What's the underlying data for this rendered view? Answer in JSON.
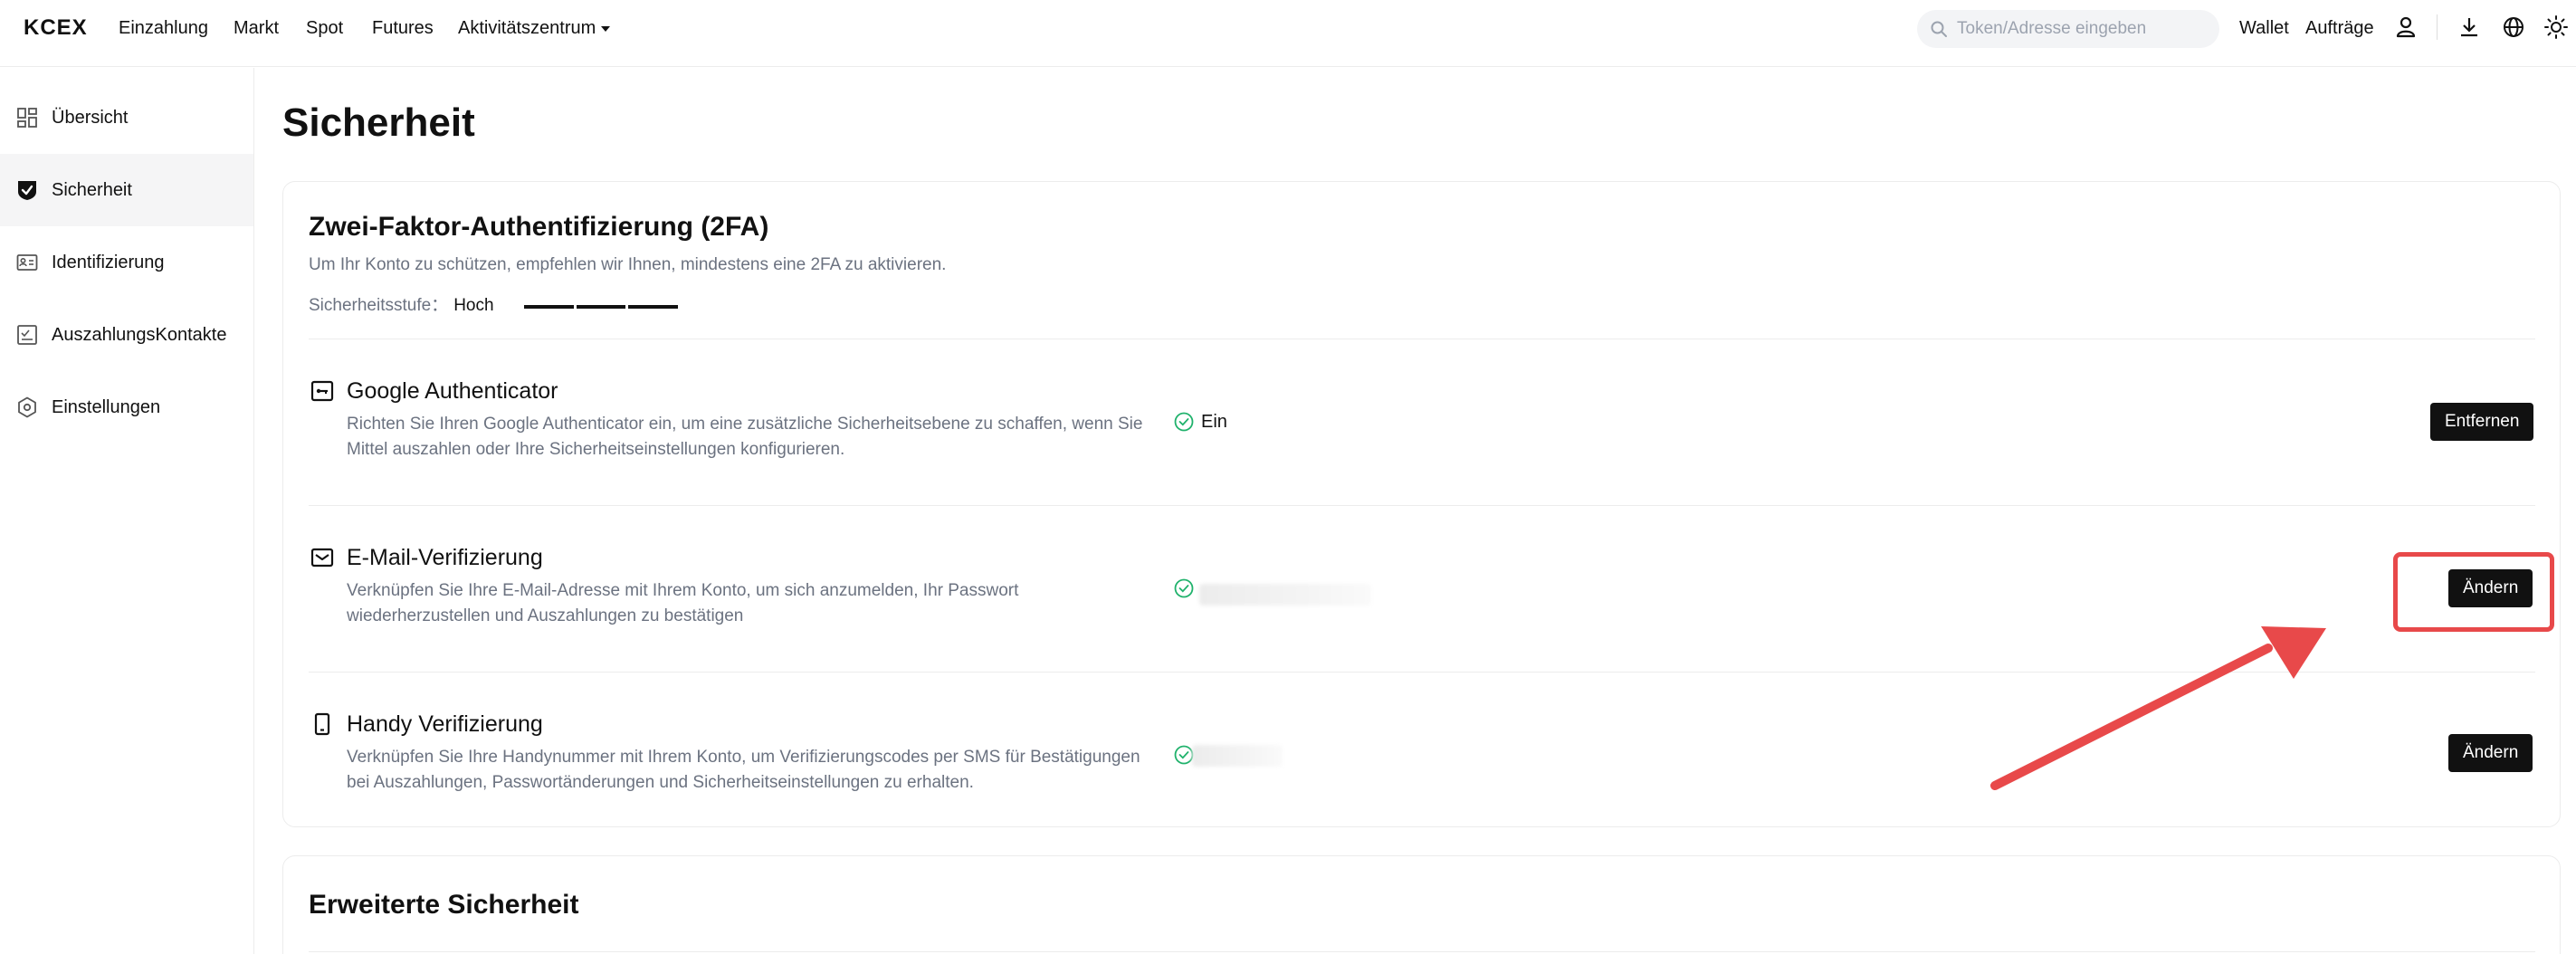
{
  "nav": {
    "logo": "KCEX",
    "items": [
      "Einzahlung",
      "Markt",
      "Spot",
      "Futures",
      "Aktivitätszentrum"
    ],
    "search_placeholder": "Token/Adresse eingeben",
    "wallet": "Wallet",
    "orders": "Aufträge",
    "icons": [
      "search-icon",
      "user-icon",
      "download-icon",
      "globe-icon",
      "sun-icon"
    ]
  },
  "sidebar": {
    "items": [
      {
        "label": "Übersicht",
        "icon": "dashboard-icon"
      },
      {
        "label": "Sicherheit",
        "icon": "shield-check-icon",
        "active": true
      },
      {
        "label": "Identifizierung",
        "icon": "id-card-icon"
      },
      {
        "label": "AuszahlungsKontakte",
        "icon": "address-book-icon"
      },
      {
        "label": "Einstellungen",
        "icon": "settings-icon"
      }
    ]
  },
  "main": {
    "title": "Sicherheit",
    "twofa": {
      "title": "Zwei-Faktor-Authentifizierung (2FA)",
      "subtitle": "Um Ihr Konto zu schützen, empfehlen wir Ihnen, mindestens eine 2FA zu aktivieren.",
      "level_label": "Sicherheitsstufe：",
      "level_value": "Hoch",
      "level_bars_filled": 3,
      "rows": [
        {
          "title": "Google Authenticator",
          "desc": "Richten Sie Ihren Google Authenticator ein, um eine zusätzliche Sicherheitsebene zu schaffen, wenn Sie Mittel auszahlen oder Ihre Sicherheitseinstellungen konfigurieren.",
          "status": "Ein",
          "button": "Entfernen",
          "icon": "authenticator-icon"
        },
        {
          "title": "E-Mail-Verifizierung",
          "desc": "Verknüpfen Sie Ihre E-Mail-Adresse mit Ihrem Konto, um sich anzumelden, Ihr Passwort wiederherzustellen und Auszahlungen zu bestätigen",
          "status": "",
          "button": "Ändern",
          "icon": "mail-icon"
        },
        {
          "title": "Handy Verifizierung",
          "desc": "Verknüpfen Sie Ihre Handynummer mit Ihrem Konto, um Verifizierungscodes per SMS für Bestätigungen bei Auszahlungen, Passwortänderungen und Sicherheitseinstellungen zu erhalten.",
          "status": "",
          "button": "Ändern",
          "icon": "phone-icon"
        }
      ]
    },
    "advanced": {
      "title": "Erweiterte Sicherheit"
    }
  },
  "colors": {
    "accent": "#111111",
    "success": "#20b26c",
    "annotation": "#e8494a"
  }
}
